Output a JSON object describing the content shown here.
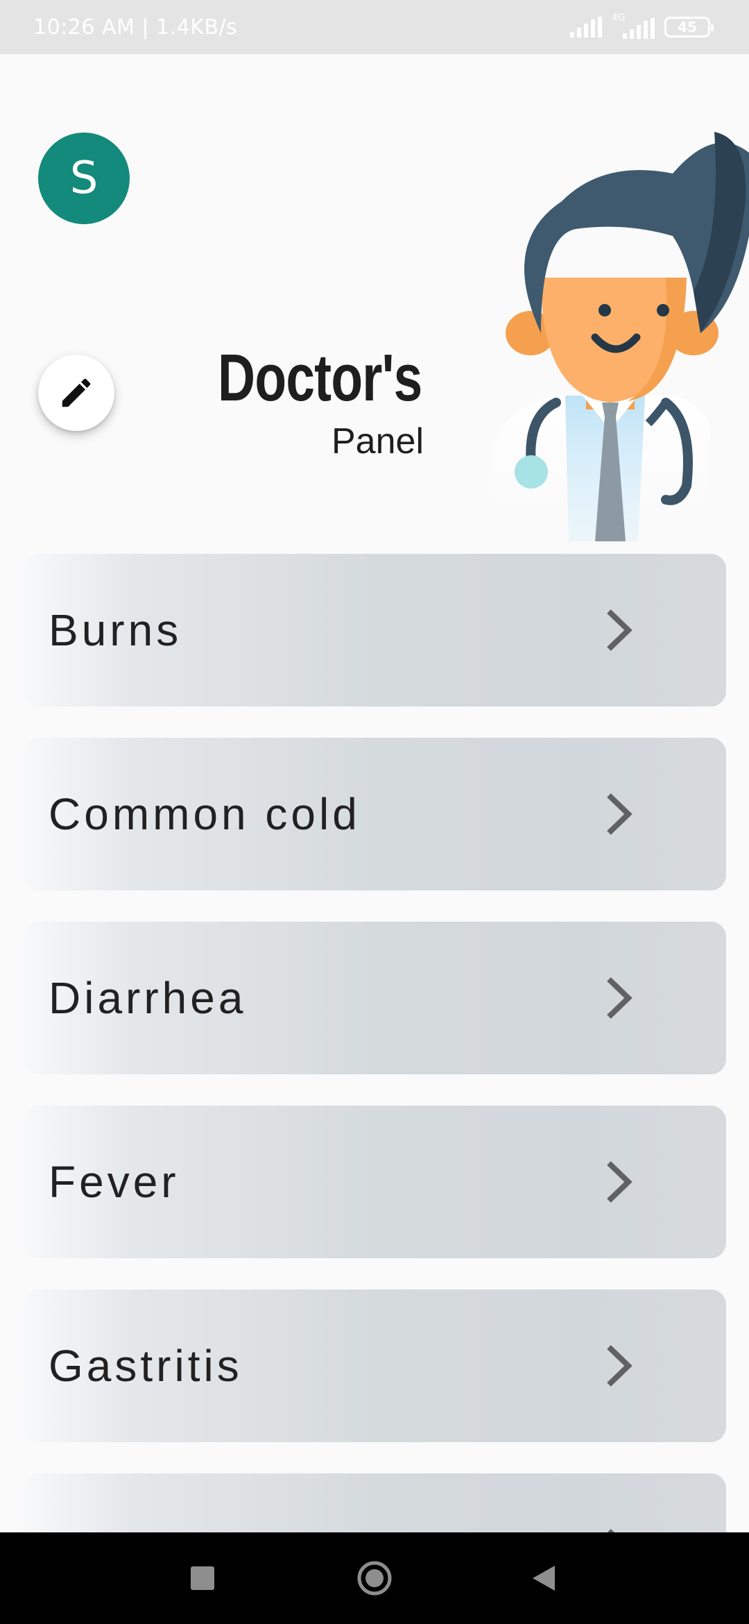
{
  "status_bar": {
    "time_speed": "10:26 AM | 1.4KB/s",
    "network_type": "4G",
    "battery": "45",
    "signal_icon": "signal-icon",
    "battery_icon": "battery-icon"
  },
  "header": {
    "avatar_letter": "S",
    "title": "Doctor's",
    "subtitle": "Panel",
    "edit_icon": "pencil-icon",
    "illustration": "doctor-illustration"
  },
  "diseases": [
    {
      "label": "Burns"
    },
    {
      "label": "Common cold"
    },
    {
      "label": "Diarrhea"
    },
    {
      "label": "Fever"
    },
    {
      "label": "Gastritis"
    },
    {
      "label": ""
    }
  ],
  "nav": {
    "recents_icon": "square-icon",
    "home_icon": "circle-home-icon",
    "back_icon": "back-triangle-icon"
  },
  "colors": {
    "avatar": "#138a7b",
    "card_gradient_start": "#f7f8f9",
    "card_gradient_end": "#d2d7db",
    "chevron": "#5f6164"
  }
}
